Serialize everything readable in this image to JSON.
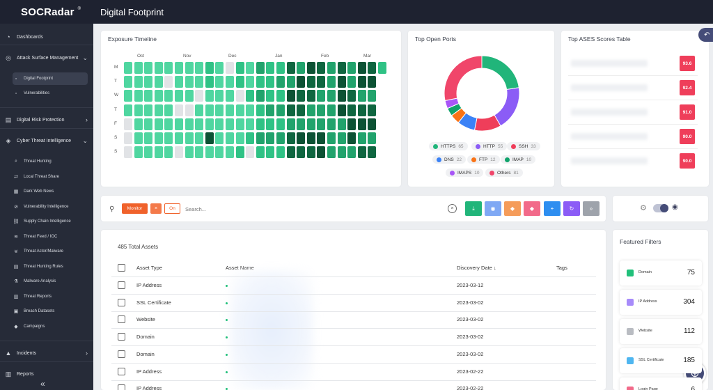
{
  "app": {
    "logo": "SOCRadar",
    "page_title": "Digital Footprint"
  },
  "sidebar": {
    "items": [
      {
        "label": "Dashboards",
        "icon": "speedometer-icon"
      },
      {
        "label": "Attack Surface Management",
        "icon": "target-icon",
        "chevron": "⌄"
      },
      {
        "label": "Digital Risk Protection",
        "icon": "document-icon",
        "chevron": "›"
      },
      {
        "label": "Cyber Threat Intelligence",
        "icon": "shield-icon",
        "chevron": "⌄"
      },
      {
        "label": "Incidents",
        "icon": "warning-icon",
        "chevron": "›"
      },
      {
        "label": "Reports",
        "icon": "report-icon"
      }
    ],
    "asm_sub": [
      "Digital Footprint",
      "Vulnerabilities"
    ],
    "cti_sub": [
      "Threat Hunting",
      "Local Threat Share",
      "Dark Web News",
      "Vulnerability Intelligence",
      "Supply Chain Intelligence",
      "Threat Feed / IOC",
      "Threat Actor/Malware",
      "Threat Hunting Rules",
      "Malware Analysis",
      "Threat Reports",
      "Breach Datasets",
      "Campaigns"
    ],
    "collapse": "«"
  },
  "exposure": {
    "title": "Exposure Timeline",
    "months": [
      "Oct",
      "Nov",
      "Dec",
      "Jan",
      "Feb",
      "Mar"
    ],
    "days": [
      "M",
      "T",
      "W",
      "T",
      "F",
      "S",
      "S"
    ]
  },
  "ports": {
    "title": "Top Open Ports",
    "slices": [
      {
        "name": "HTTPS",
        "value": 65,
        "color": "#21b57a"
      },
      {
        "name": "HTTP",
        "value": 55,
        "color": "#8b5cf6"
      },
      {
        "name": "SSH",
        "value": 33,
        "color": "#ef3e5a"
      },
      {
        "name": "DNS",
        "value": 22,
        "color": "#3b82f6"
      },
      {
        "name": "FTP",
        "value": 12,
        "color": "#f97316"
      },
      {
        "name": "IMAP",
        "value": 10,
        "color": "#10a36b"
      },
      {
        "name": "IMAPS",
        "value": 10,
        "color": "#a855f7"
      },
      {
        "name": "Others",
        "value": 81,
        "color": "#f0466a"
      }
    ]
  },
  "ases": {
    "title": "Top ASES Scores Table",
    "scores": [
      "93.6",
      "92.4",
      "91.0",
      "90.0",
      "90.0"
    ]
  },
  "toolbar": {
    "monitor": "Monitor",
    "close_x": "×",
    "on": "On",
    "search_placeholder": "Search...",
    "clear": "×",
    "buttons": [
      {
        "icon": "download-icon",
        "glyph": "⤓",
        "color": "#21b57a"
      },
      {
        "icon": "eye-icon",
        "glyph": "◉",
        "color": "#7fa8f4"
      },
      {
        "icon": "tag-icon",
        "glyph": "◆",
        "color": "#f59c5a"
      },
      {
        "icon": "untag-icon",
        "glyph": "◆",
        "color": "#f26a8a"
      },
      {
        "icon": "plus-icon",
        "glyph": "+",
        "color": "#2e8ef0"
      },
      {
        "icon": "refresh-icon",
        "glyph": "↻",
        "color": "#8b5cf6"
      },
      {
        "icon": "expand-icon",
        "glyph": "»",
        "color": "#9ea3ab"
      }
    ]
  },
  "assets": {
    "total": "485 Total Assets",
    "columns": {
      "type": "Asset Type",
      "name": "Asset Name",
      "date": "Discovery Date",
      "sort": "↓",
      "tags": "Tags"
    },
    "rows": [
      {
        "type": "IP Address",
        "date": "2023-03-12"
      },
      {
        "type": "SSL Certificate",
        "date": "2023-03-02"
      },
      {
        "type": "Website",
        "date": "2023-03-02"
      },
      {
        "type": "Domain",
        "date": "2023-03-02"
      },
      {
        "type": "Domain",
        "date": "2023-03-02"
      },
      {
        "type": "IP Address",
        "date": "2023-02-22"
      },
      {
        "type": "IP Address",
        "date": "2023-02-22"
      }
    ]
  },
  "featured": {
    "title": "Featured Filters",
    "items": [
      {
        "name": "Domain",
        "count": "75",
        "color": "#21c07a"
      },
      {
        "name": "IP Address",
        "count": "304",
        "color": "#a78bfa"
      },
      {
        "name": "Website",
        "count": "112",
        "color": "#b9bcc2"
      },
      {
        "name": "SSL Certificate",
        "count": "185",
        "color": "#4fb6f0"
      },
      {
        "name": "Login Page",
        "count": "6",
        "color": "#f26a8a"
      }
    ]
  }
}
